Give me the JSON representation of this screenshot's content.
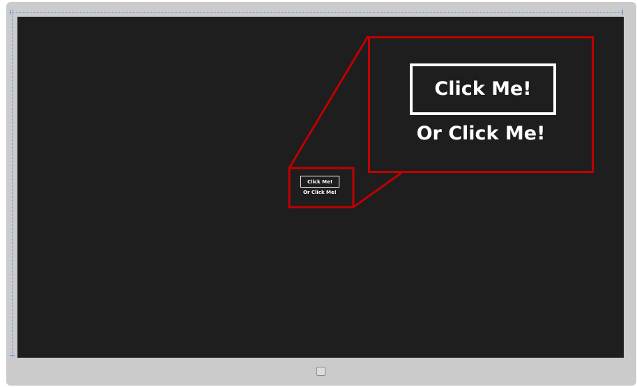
{
  "app": {
    "primary_button_label": "Click Me!",
    "secondary_link_label": "Or Click Me!"
  },
  "zoom_callout": {
    "primary_button_label": "Click Me!",
    "secondary_link_label": "Or Click Me!",
    "highlight_color": "#c00000"
  },
  "device": {
    "screen_color": "#1e1e1e",
    "frame_color": "#cbcbcb",
    "home_icon": "windows-home-icon"
  }
}
